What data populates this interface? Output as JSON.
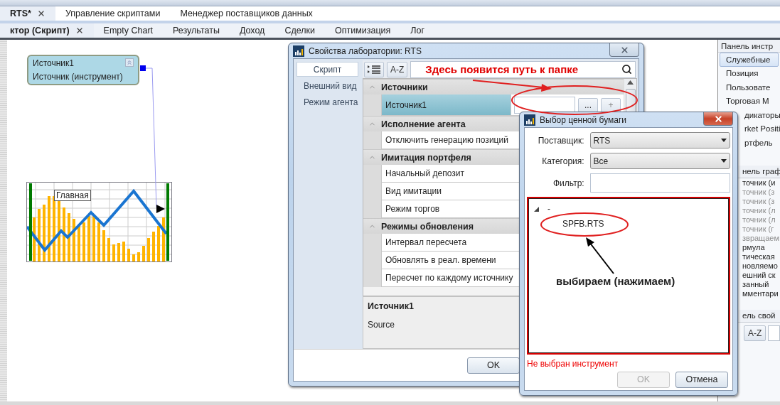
{
  "document_tabs": [
    {
      "label": "RTS*",
      "selected": true,
      "closable": true
    },
    {
      "label": "Управление скриптами",
      "selected": false,
      "closable": false
    },
    {
      "label": "Менеджер поставщиков данных",
      "selected": false,
      "closable": false
    }
  ],
  "view_tabs": [
    {
      "label": "ктор (Скрипт)",
      "selected": true,
      "closable": true
    },
    {
      "label": "Empty Chart",
      "selected": false,
      "closable": false
    },
    {
      "label": "Результаты",
      "selected": false,
      "closable": false
    },
    {
      "label": "Доход",
      "selected": false,
      "closable": false
    },
    {
      "label": "Сделки",
      "selected": false,
      "closable": false
    },
    {
      "label": "Оптимизация",
      "selected": false,
      "closable": false
    },
    {
      "label": "Лог",
      "selected": false,
      "closable": false
    }
  ],
  "canvas": {
    "source_node": {
      "title": "Источник1",
      "subtitle": "Источник (инструмент)"
    },
    "chart_node": {
      "label": "Главная"
    }
  },
  "tool_panel": {
    "title": "Панель инстр",
    "items": [
      {
        "label": "Служебные",
        "selected": true,
        "kind": "full"
      },
      {
        "label": "Позиция",
        "selected": false,
        "kind": "full"
      },
      {
        "label": "Пользовате",
        "selected": false,
        "kind": "full"
      },
      {
        "label": "Торговая М",
        "selected": false,
        "kind": "full"
      },
      {
        "label": "дикаторы",
        "selected": false,
        "kind": "partial"
      },
      {
        "label": "rket Positi",
        "selected": false,
        "kind": "partial"
      },
      {
        "label": "ртфель",
        "selected": false,
        "kind": "partial"
      }
    ]
  },
  "graphics_panel": {
    "title": "нель граф",
    "items": [
      {
        "label": "точник (и",
        "disabled": false
      },
      {
        "label": "точник (з",
        "disabled": true
      },
      {
        "label": "точник (з",
        "disabled": true
      },
      {
        "label": "точник (л",
        "disabled": true
      },
      {
        "label": "точник (л",
        "disabled": true
      },
      {
        "label": "точник (г",
        "disabled": true
      },
      {
        "label": "звращаем",
        "disabled": true
      },
      {
        "label": "рмула",
        "disabled": false
      },
      {
        "label": "тическая",
        "disabled": false
      },
      {
        "label": "новляемо",
        "disabled": false
      },
      {
        "label": "ешний ск",
        "disabled": false
      },
      {
        "label": "занный",
        "disabled": false
      },
      {
        "label": "мментари",
        "disabled": false
      }
    ]
  },
  "properties_panel": {
    "title": "ель свой",
    "sort_button": "A-Z"
  },
  "properties_dialog": {
    "title": "Свойства лаборатории: RTS",
    "nav": [
      {
        "label": "Скрипт",
        "selected": true
      },
      {
        "label": "Внешний вид",
        "selected": false
      },
      {
        "label": "Режим агента",
        "selected": false
      }
    ],
    "sort_button": "A-Z",
    "search_annotation": "Здесь появится путь к папке",
    "categories": [
      {
        "title": "Источники",
        "expanded": true,
        "rows": [
          {
            "name": "Источник1",
            "selected": true,
            "kind": "picker",
            "browse_button": "...",
            "add_button": "+"
          }
        ]
      },
      {
        "title": "Исполнение агента",
        "expanded": true,
        "rows": [
          {
            "name": "Отключить генерацию позиций",
            "selected": false,
            "kind": "plain"
          }
        ]
      },
      {
        "title": "Имитация портфеля",
        "expanded": true,
        "rows": [
          {
            "name": "Начальный депозит",
            "selected": false,
            "kind": "plain"
          },
          {
            "name": "Вид имитации",
            "selected": false,
            "kind": "plain"
          },
          {
            "name": "Режим торгов",
            "selected": false,
            "kind": "plain"
          }
        ]
      },
      {
        "title": "Режимы обновления",
        "expanded": true,
        "rows": [
          {
            "name": "Интервал пересчета",
            "selected": false,
            "kind": "plain"
          },
          {
            "name": "Обновлять в реал. времени",
            "selected": false,
            "kind": "plain"
          },
          {
            "name": "Пересчет по каждому источнику",
            "selected": false,
            "kind": "plain"
          }
        ]
      }
    ],
    "description": {
      "title": "Источник1",
      "text": "Source"
    },
    "ok_button": "OK"
  },
  "security_dialog": {
    "title": "Выбор ценной бумаги",
    "fields": [
      {
        "label": "Поставщик:",
        "kind": "dropdown",
        "value": "RTS"
      },
      {
        "label": "Категория:",
        "kind": "dropdown",
        "value": "Все"
      },
      {
        "label": "Фильтр:",
        "kind": "text"
      }
    ],
    "tree": {
      "label": "-",
      "expanded": true,
      "children": [
        {
          "label": "SPFB.RTS"
        }
      ]
    },
    "annotation": "выбираем (нажимаем)",
    "error": "Не выбран инструмент",
    "buttons": [
      {
        "label": "OK",
        "disabled": true
      },
      {
        "label": "Отмена",
        "disabled": false
      }
    ]
  }
}
